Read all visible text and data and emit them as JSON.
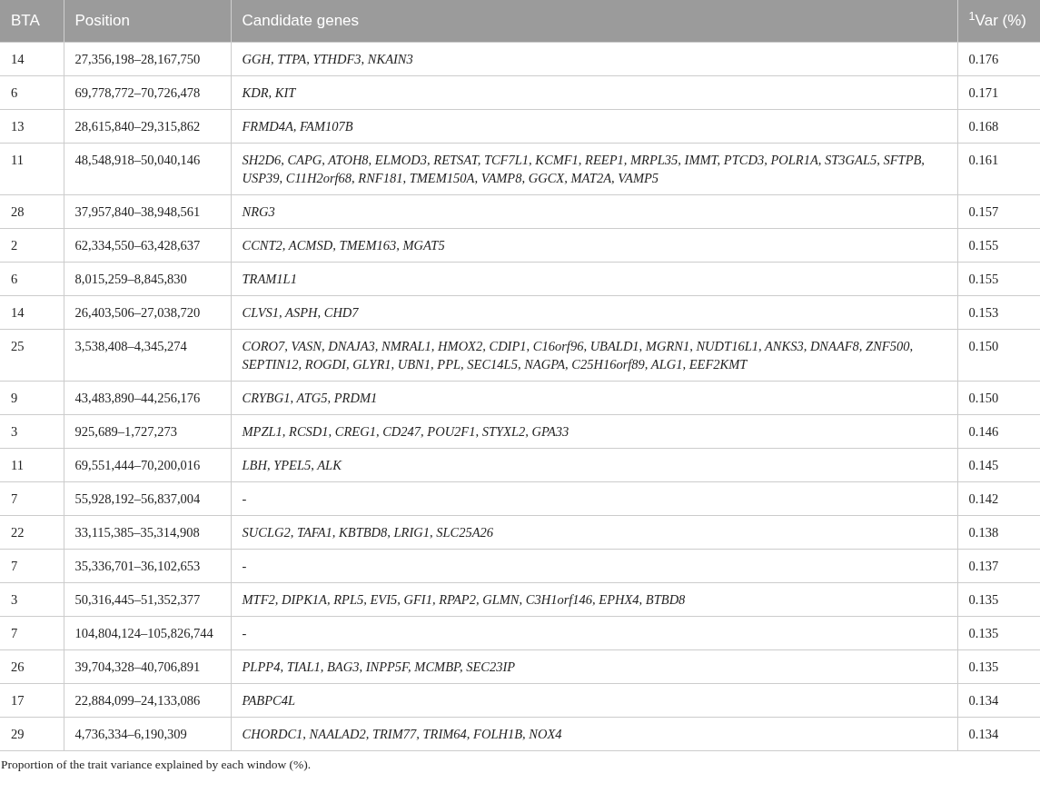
{
  "table": {
    "columns": [
      "BTA",
      "Position",
      "Candidate genes",
      "$^{1}$Var (%)"
    ],
    "rows": [
      [
        "14",
        "27,356,198–28,167,750",
        "GGH, TTPA, YTHDF3, NKAIN3",
        "0.176"
      ],
      [
        "6",
        "69,778,772–70,726,478",
        "KDR, KIT",
        "0.171"
      ],
      [
        "13",
        "28,615,840–29,315,862",
        "FRMD4A, FAM107B",
        "0.168"
      ],
      [
        "11",
        "48,548,918–50,040,146",
        "SH2D6, CAPG, ATOH8, ELMOD3, RETSAT, TCF7L1, KCMF1, REEP1, MRPL35, IMMT, PTCD3, POLR1A, ST3GAL5, SFTPB, USP39, C11H2orf68, RNF181, TMEM150A, VAMP8, GGCX, MAT2A, VAMP5",
        "0.161"
      ],
      [
        "28",
        "37,957,840–38,948,561",
        "NRG3",
        "0.157"
      ],
      [
        "2",
        "62,334,550–63,428,637",
        "CCNT2, ACMSD, TMEM163, MGAT5",
        "0.155"
      ],
      [
        "6",
        "8,015,259–8,845,830",
        "TRAM1L1",
        "0.155"
      ],
      [
        "14",
        "26,403,506–27,038,720",
        "CLVS1, ASPH, CHD7",
        "0.153"
      ],
      [
        "25",
        "3,538,408–4,345,274",
        "CORO7, VASN, DNAJA3, NMRAL1, HMOX2, CDIP1, C16orf96, UBALD1, MGRN1, NUDT16L1, ANKS3, DNAAF8, ZNF500, SEPTIN12, ROGDI, GLYR1, UBN1, PPL, SEC14L5, NAGPA, C25H16orf89, ALG1, EEF2KMT",
        "0.150"
      ],
      [
        "9",
        "43,483,890–44,256,176",
        "CRYBG1, ATG5, PRDM1",
        "0.150"
      ],
      [
        "3",
        "925,689–1,727,273",
        "MPZL1, RCSD1, CREG1, CD247, POU2F1, STYXL2, GPA33",
        "0.146"
      ],
      [
        "11",
        "69,551,444–70,200,016",
        "LBH, YPEL5, ALK",
        "0.145"
      ],
      [
        "7",
        "55,928,192–56,837,004",
        "-",
        "0.142"
      ],
      [
        "22",
        "33,115,385–35,314,908",
        "SUCLG2, TAFA1, KBTBD8, LRIG1, SLC25A26",
        "0.138"
      ],
      [
        "7",
        "35,336,701–36,102,653",
        "-",
        "0.137"
      ],
      [
        "3",
        "50,316,445–51,352,377",
        "MTF2, DIPK1A, RPL5, EVI5, GFI1, RPAP2, GLMN, C3H1orf146, EPHX4, BTBD8",
        "0.135"
      ],
      [
        "7",
        "104,804,124–105,826,744",
        "-",
        "0.135"
      ],
      [
        "26",
        "39,704,328–40,706,891",
        "PLPP4, TIAL1, BAG3, INPP5F, MCMBP, SEC23IP",
        "0.135"
      ],
      [
        "17",
        "22,884,099–24,133,086",
        "PABPC4L",
        "0.134"
      ],
      [
        "29",
        "4,736,334–6,190,309",
        "CHORDC1, NAALAD2, TRIM77, TRIM64, FOLH1B, NOX4",
        "0.134"
      ]
    ]
  },
  "footnote": "Proportion of the trait variance explained by each window (%)."
}
